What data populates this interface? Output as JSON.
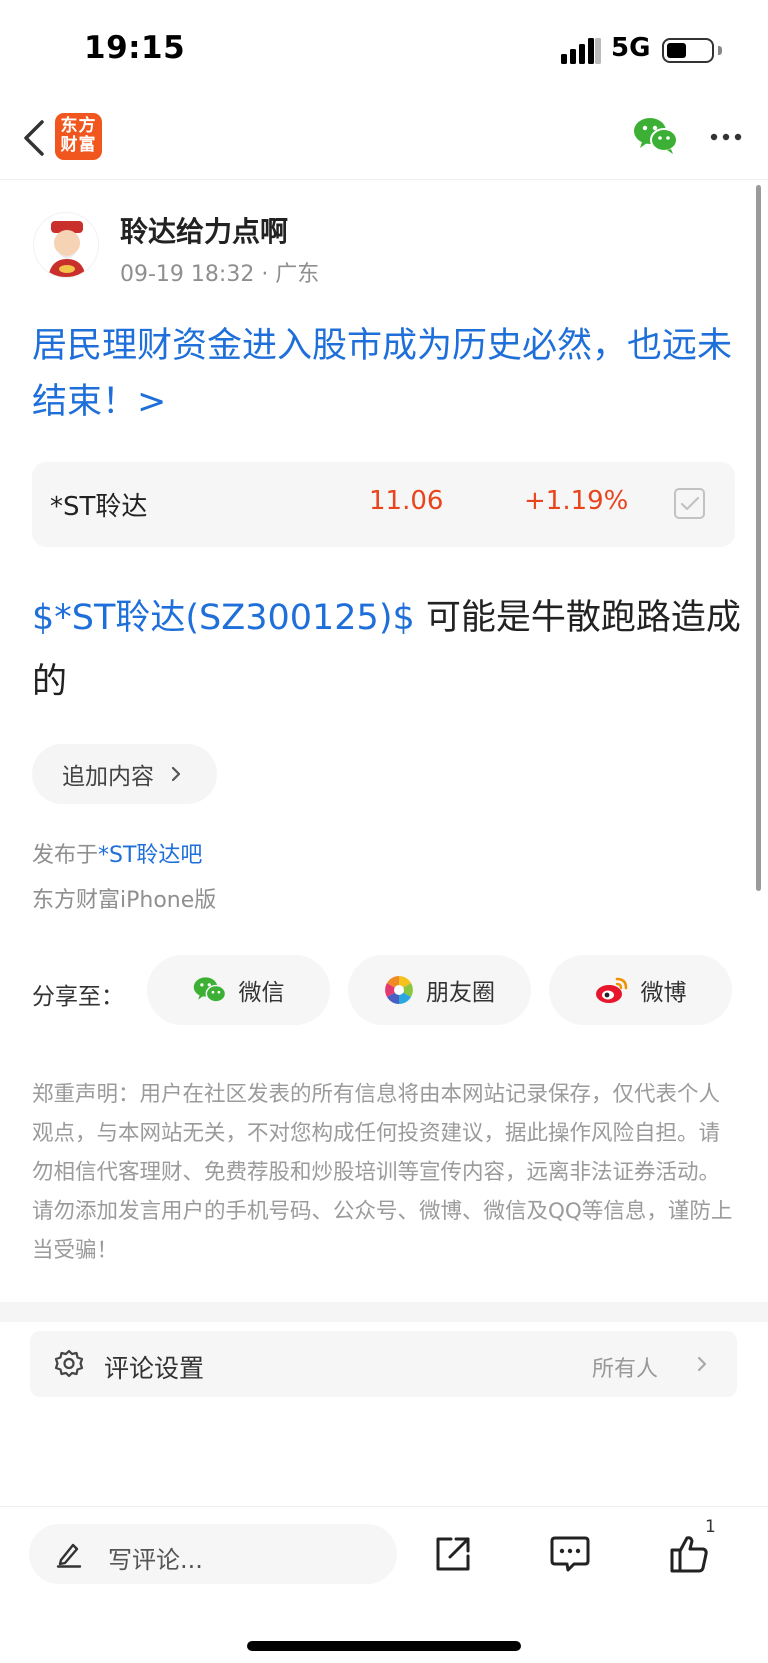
{
  "status_bar": {
    "time": "19:15",
    "network": "5G",
    "battery_level": 0.45
  },
  "nav": {
    "logo_text": "东方\n财富"
  },
  "author": {
    "name": "聆达给力点啊",
    "meta": "09-19 18:32 · 广东"
  },
  "post": {
    "title": "居民理财资金进入股市成为历史必然，也远未结束！>",
    "body_link": "$*ST聆达(SZ300125)$",
    "body_text": " 可能是牛散跑路造成的"
  },
  "stock_card": {
    "name": "*ST聆达",
    "price": "11.06",
    "change": "+1.19%"
  },
  "add_content_label": "追加内容",
  "published": {
    "prefix": "发布于",
    "forum": "*ST聆达吧"
  },
  "client": "东方财富iPhone版",
  "share": {
    "label": "分享至：",
    "wechat": "微信",
    "moments": "朋友圈",
    "weibo": "微博"
  },
  "disclaimer": "郑重声明：用户在社区发表的所有信息将由本网站记录保存，仅代表个人观点，与本网站无关，不对您构成任何投资建议，据此操作风险自担。请勿相信代客理财、免费荐股和炒股培训等宣传内容，远离非法证券活动。请勿添加发言用户的手机号码、公众号、微博、微信及QQ等信息，谨防上当受骗！",
  "comment_settings": {
    "label": "评论设置",
    "value": "所有人"
  },
  "bottom_bar": {
    "comment_placeholder": "写评论...",
    "like_count": "1"
  },
  "colors": {
    "accent_blue": "#1e6fd9",
    "stock_red": "#e8451d",
    "brand_orange": "#f0561d",
    "wechat_green": "#3cb034"
  },
  "icons": [
    "back-chevron-icon",
    "wechat-icon",
    "more-icon",
    "check-icon",
    "chevron-right-icon",
    "moments-icon",
    "weibo-icon",
    "gear-icon",
    "pencil-icon",
    "share-icon",
    "comment-icon",
    "like-icon"
  ]
}
